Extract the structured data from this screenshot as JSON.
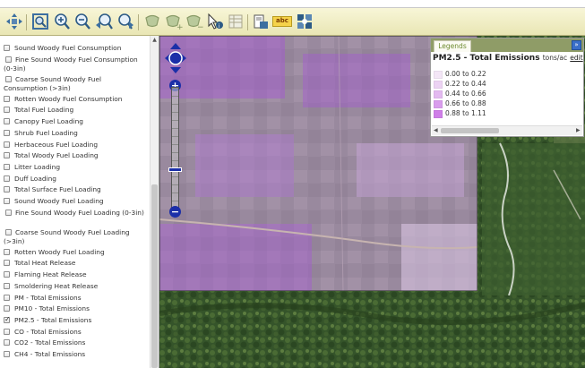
{
  "toolbar": {
    "tools": [
      {
        "name": "pan-tool",
        "icon": "pan-arrows-icon"
      },
      {
        "name": "zoom-extent-tool",
        "icon": "zoom-extent-icon"
      },
      {
        "name": "zoom-in-tool",
        "icon": "zoom-in-icon"
      },
      {
        "name": "zoom-out-tool",
        "icon": "zoom-out-icon"
      },
      {
        "name": "zoom-previous-tool",
        "icon": "zoom-previous-icon"
      },
      {
        "name": "zoom-next-tool",
        "icon": "zoom-next-icon"
      },
      {
        "name": "select-tool",
        "icon": "select-shape-icon"
      },
      {
        "name": "select-add-tool",
        "icon": "select-add-icon"
      },
      {
        "name": "select-remove-tool",
        "icon": "select-remove-icon"
      },
      {
        "name": "identify-tool",
        "icon": "identify-icon"
      },
      {
        "name": "attribute-table-tool",
        "icon": "table-icon"
      },
      {
        "name": "print-tool",
        "icon": "print-icon"
      },
      {
        "name": "label-tool",
        "icon": "abc-label-icon",
        "label": "abc"
      },
      {
        "name": "layers-tool",
        "icon": "layers-icon"
      }
    ],
    "accent": "#e9e6b4"
  },
  "sidebar": {
    "layers": [
      {
        "label": "Sound Woody Fuel Consumption",
        "checked": false
      },
      {
        "label": "Fine Sound Woody Fuel Consumption (0-3in)",
        "checked": false
      },
      {
        "label": "Coarse Sound Woody Fuel Consumption (>3in)",
        "checked": false
      },
      {
        "label": "Rotten Woody Fuel Consumption",
        "checked": false
      },
      {
        "label": "Total Fuel Loading",
        "checked": false
      },
      {
        "label": "Canopy Fuel Loading",
        "checked": false
      },
      {
        "label": "Shrub Fuel Loading",
        "checked": false
      },
      {
        "label": "Herbaceous Fuel Loading",
        "checked": false
      },
      {
        "label": "Total Woody Fuel Loading",
        "checked": false
      },
      {
        "label": "Litter Loading",
        "checked": false
      },
      {
        "label": "Duff Loading",
        "checked": false
      },
      {
        "label": "Total Surface Fuel Loading",
        "checked": false
      },
      {
        "label": "Sound Woody Fuel Loading",
        "checked": false
      },
      {
        "label": "Fine Sound Woody Fuel Loading (0-3in)",
        "checked": false
      },
      {
        "label": "Coarse Sound Woody Fuel Loading (>3in)",
        "checked": false
      },
      {
        "label": "Rotten Woody Fuel Loading",
        "checked": false
      },
      {
        "label": "Total Heat Release",
        "checked": false
      },
      {
        "label": "Flaming Heat Release",
        "checked": false
      },
      {
        "label": "Smoldering Heat Release",
        "checked": false
      },
      {
        "label": "PM - Total Emissions",
        "checked": false
      },
      {
        "label": "PM10 - Total Emissions",
        "checked": false
      },
      {
        "label": "PM2.5 - Total Emissions",
        "checked": true
      },
      {
        "label": "CO - Total Emissions",
        "checked": false
      },
      {
        "label": "CO2 - Total Emissions",
        "checked": false
      },
      {
        "label": "CH4 - Total Emissions",
        "checked": false
      }
    ]
  },
  "map": {
    "zoom_in_label": "+",
    "zoom_out_label": "−",
    "overlay_color": "#a468c8"
  },
  "legend": {
    "tab_label": "Legends",
    "collapse_label": "»",
    "layer_title": "PM2.5 - Total Emissions",
    "units": "tons/ac",
    "edit_label": "edit",
    "classes": [
      {
        "label": "0.00 to 0.22",
        "color": "#f3e6f6"
      },
      {
        "label": "0.22 to 0.44",
        "color": "#ecd3f3"
      },
      {
        "label": "0.44 to 0.66",
        "color": "#e3baf0"
      },
      {
        "label": "0.66 to 0.88",
        "color": "#d99ded"
      },
      {
        "label": "0.88 to 1.11",
        "color": "#cf7fe8"
      }
    ]
  }
}
